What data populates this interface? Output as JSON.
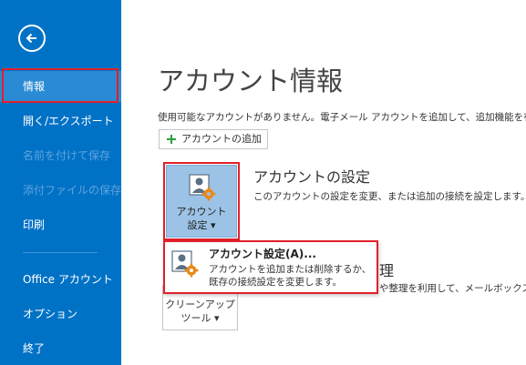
{
  "sidebar": {
    "items": [
      {
        "label": "情報",
        "state": "selected"
      },
      {
        "label": "開く/エクスポート",
        "state": "enabled"
      },
      {
        "label": "名前を付けて保存",
        "state": "disabled"
      },
      {
        "label": "添付ファイルの保存",
        "state": "disabled"
      },
      {
        "label": "印刷",
        "state": "enabled"
      },
      {
        "label": "Office アカウント",
        "state": "enabled"
      },
      {
        "label": "オプション",
        "state": "enabled"
      },
      {
        "label": "終了",
        "state": "enabled"
      }
    ]
  },
  "main": {
    "title": "アカウント情報",
    "info_text": "使用可能なアカウントがありません。電子メール アカウントを追加して、追加機能を有効",
    "add_account_label": "アカウントの追加",
    "account_settings": {
      "button_line1": "アカウント",
      "button_line2": "設定 ▾",
      "heading": "アカウントの設定",
      "description": "このアカウントの設定を変更、または追加の接続を設定します。"
    },
    "cleanup": {
      "button_line1": "クリーンアップ",
      "button_line2": "ツール ▾",
      "heading_visible": "理",
      "description_visible": "や整理を利用して、メールボックスの"
    },
    "dropdown": {
      "title": "アカウント設定(A)...",
      "title_underline_char": "A",
      "desc_line1": "アカウントを追加または削除するか、",
      "desc_line2": "既存の接続設定を変更します。"
    }
  },
  "colors": {
    "sidebar_bg": "#0072c6",
    "sidebar_selected": "#2a8ad4",
    "highlight_outline": "#e0202a",
    "settings_button_bg": "#9cc3e5"
  },
  "icons": {
    "back": "back-arrow-icon",
    "add": "plus-icon",
    "account_settings": "account-settings-icon"
  }
}
